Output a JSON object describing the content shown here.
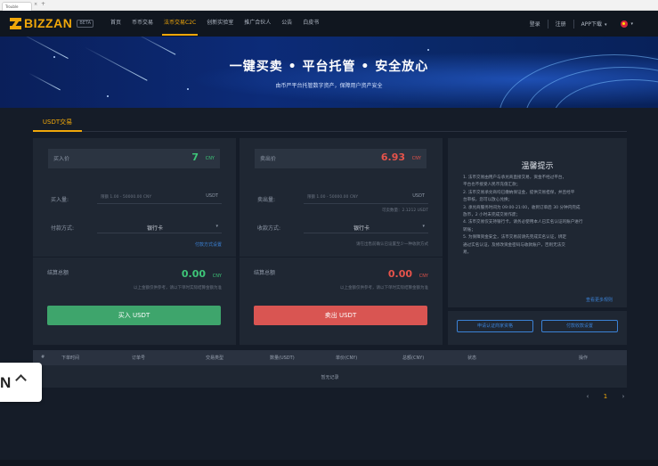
{
  "browser": {
    "tab_label": "Trouble",
    "close": "×",
    "new_tab": "+"
  },
  "nav": {
    "logo": "BIZZAN",
    "badge": "BETA",
    "links": [
      "首页",
      "币币交易",
      "法币交易C2C",
      "创新实验室",
      "推广合伙人",
      "公告",
      "白皮书"
    ],
    "active_index": 2,
    "login": "登录",
    "register": "注册",
    "app_download": "APP下载",
    "chevron": "▾"
  },
  "banner": {
    "title": "一键买卖 • 平台托管 • 安全放心",
    "subtitle": "由币严平台托管数字资产，保障用户资产安全"
  },
  "tabs": {
    "active": "USDT交易"
  },
  "buy": {
    "price_label": "买入价",
    "price": "7",
    "currency": "CNY",
    "amount_label": "买入量:",
    "amount_placeholder": "限额 1.00 - 50000.00 CNY",
    "amount_unit": "USDT",
    "pay_label": "付款方式:",
    "pay_value": "银行卡",
    "pay_link": "付款方式设置",
    "total_label": "结算总额",
    "total_value": "0.00",
    "total_currency": "CNY",
    "total_note": "以上金额仅供参考，请以下单时实际结算金额为准",
    "button": "买入 USDT"
  },
  "sell": {
    "price_label": "卖出价",
    "price": "6.93",
    "currency": "CNY",
    "amount_label": "卖出量:",
    "amount_placeholder": "限额 1.00 - 50000.00 CNY",
    "amount_unit": "USDT",
    "available": "可卖数量：2.1212 USDT",
    "pay_label": "收款方式:",
    "pay_value": "银行卡",
    "pay_note": "请在出售前确认已设置至少一种收款方式",
    "total_label": "结算总额",
    "total_value": "0.00",
    "total_currency": "CNY",
    "total_note": "以上金额仅供参考，请以下单时实际结算金额为准",
    "button": "卖出 USDT"
  },
  "tips": {
    "title": "温馨提示",
    "items": [
      "1. 法币交易由用户与承兑商直接交易，资金不经过平台，",
      "平台也不接受人民币充值汇款；",
      "2. 法币交易承兑商均已缴纳保证金，提供交易担保，并且经平",
      "台审核，您可以放心兑换；",
      "3. 承兑商服务时间为 09:00-21:00，收到订单后 30 分钟内完成",
      "放币，2 小时未完成交易作废；",
      "4. 法币交易仅支持银行卡，请务必使用本人已实名认证的账户进行",
      "转账；",
      "5. 为保障资金安全，法币交易前请先完成实名认证，绑定",
      "通过实名认证，及修改资金密码与收款账户，否则无法交",
      "易。"
    ],
    "more": "查看更多规则"
  },
  "links": {
    "become_merchant": "申请认证商家资格",
    "payment_settings": "付款收款设置"
  },
  "table": {
    "headers": [
      "#",
      "下单时间",
      "订单号",
      "交易类型",
      "数量(USDT)",
      "单价(CNY)",
      "总额(CNY)",
      "状态",
      "操作"
    ],
    "empty": "暂无记录"
  },
  "pager": {
    "prev": "‹",
    "current": "1",
    "next": "›"
  },
  "float": {
    "label": "N"
  }
}
